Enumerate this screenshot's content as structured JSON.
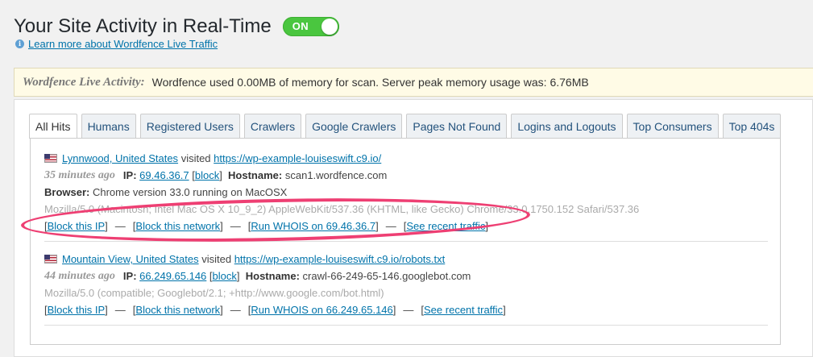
{
  "header": {
    "title": "Your Site Activity in Real-Time",
    "toggle_label": "ON",
    "learn_more": "Learn more about Wordfence Live Traffic"
  },
  "activity": {
    "label": "Wordfence Live Activity:",
    "message": "Wordfence used 0.00MB of memory for scan. Server peak memory usage was: 6.76MB"
  },
  "tabs": [
    {
      "label": "All Hits",
      "active": true
    },
    {
      "label": "Humans"
    },
    {
      "label": "Registered Users"
    },
    {
      "label": "Crawlers"
    },
    {
      "label": "Google Crawlers"
    },
    {
      "label": "Pages Not Found"
    },
    {
      "label": "Logins and Logouts"
    },
    {
      "label": "Top Consumers"
    },
    {
      "label": "Top 404s"
    }
  ],
  "hits": [
    {
      "location": "Lynnwood, United States",
      "visited": "visited",
      "url": "https://wp-example-louiseswift.c9.io/",
      "time": "35 minutes ago",
      "ip_label": "IP:",
      "ip": "69.46.36.7",
      "block": "block",
      "hostname_label": "Hostname:",
      "hostname": "scan1.wordfence.com",
      "browser_label": "Browser:",
      "browser": "Chrome version 33.0 running on MacOSX",
      "user_agent": "Mozilla/5.0 (Macintosh; Intel Mac OS X 10_9_2) AppleWebKit/537.36 (KHTML, like Gecko) Chrome/33.0.1750.152 Safari/537.36",
      "actions": {
        "block_ip": "Block this IP",
        "block_network": "Block this network",
        "whois": "Run WHOIS on 69.46.36.7",
        "recent": "See recent traffic"
      }
    },
    {
      "location": "Mountain View, United States",
      "visited": "visited",
      "url": "https://wp-example-louiseswift.c9.io/robots.txt",
      "time": "44 minutes ago",
      "ip_label": "IP:",
      "ip": "66.249.65.146",
      "block": "block",
      "hostname_label": "Hostname:",
      "hostname": "crawl-66-249-65-146.googlebot.com",
      "user_agent": "Mozilla/5.0 (compatible; Googlebot/2.1; +http://www.google.com/bot.html)",
      "actions": {
        "block_ip": "Block this IP",
        "block_network": "Block this network",
        "whois": "Run WHOIS on 66.249.65.146",
        "recent": "See recent traffic"
      }
    }
  ],
  "colors": {
    "toggle_on": "#4ac63f",
    "link": "#0073aa",
    "highlight": "#ee3f73"
  }
}
